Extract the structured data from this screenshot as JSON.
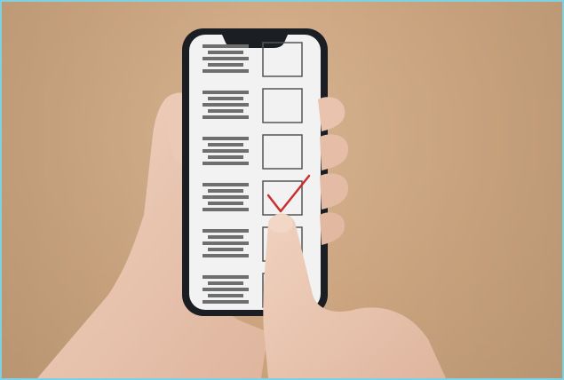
{
  "scene": {
    "background_color": "#cfa883",
    "phone_body_color": "#1b1f24",
    "screen_color": "#f2f2f2",
    "skin_color": "#e9c6b1",
    "text_line_color": "#6e6e6e",
    "checkmark_color": "#c8302f",
    "checklist": {
      "rows": [
        {
          "checked": false
        },
        {
          "checked": false
        },
        {
          "checked": false
        },
        {
          "checked": true
        },
        {
          "checked": false
        },
        {
          "checked": false
        }
      ]
    }
  }
}
